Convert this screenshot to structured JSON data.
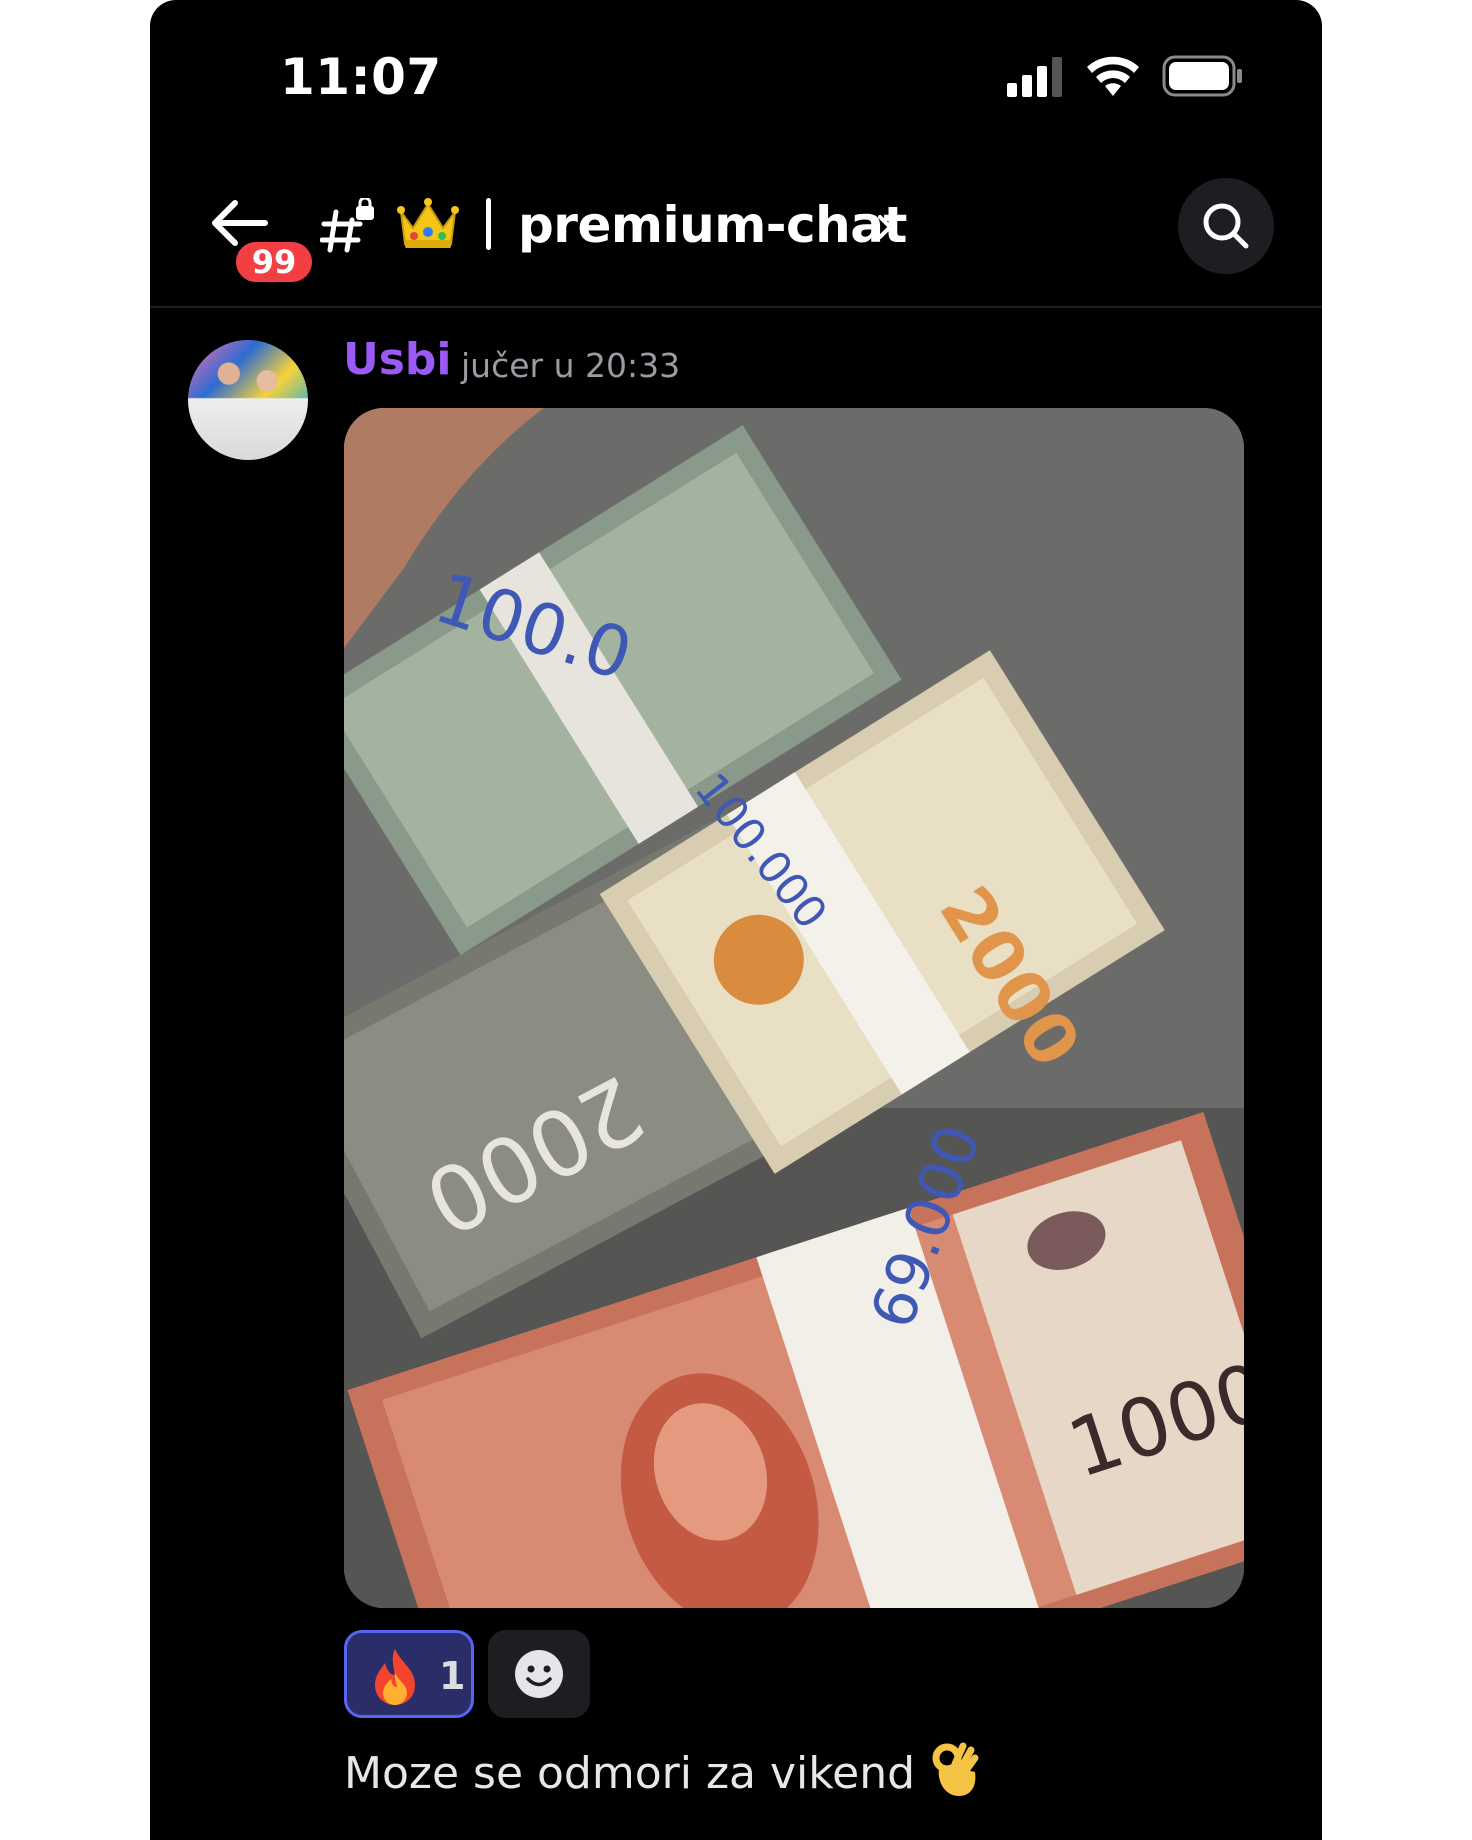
{
  "status_bar": {
    "time": "11:07",
    "icons": [
      "signal-icon",
      "wifi-icon",
      "battery-icon"
    ]
  },
  "header": {
    "back_icon": "arrow-left-icon",
    "unread_count": "99",
    "channel_icon": "locked-hashtag-icon",
    "channel_emoji": "👑",
    "channel_name": "premium-chat",
    "chevron_icon": "chevron-right-icon",
    "search_icon": "search-icon"
  },
  "message": {
    "author": "Usbi",
    "author_color": "#9b59f5",
    "timestamp": "jučer u 20:33",
    "attachment": {
      "type": "image",
      "description_icon": "photo-banknotes"
    },
    "reactions": [
      {
        "emoji": "🔥",
        "count": "1",
        "active": true
      }
    ],
    "add_reaction_icon": "smiley-icon",
    "text": "Moze se odmori za vikend",
    "text_emoji": "👌"
  },
  "colors": {
    "background": "#000000",
    "badge": "#f23f43",
    "reaction_active_bg": "#2b2d68",
    "reaction_active_border": "#5865f2"
  }
}
